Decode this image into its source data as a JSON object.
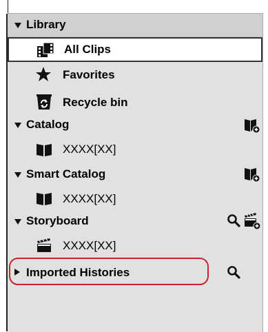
{
  "tree": {
    "library": {
      "label": "Library",
      "icon": "triangle-down-icon"
    },
    "all_clips": {
      "label": "All Clips",
      "icon": "film-clips-icon"
    },
    "favorites": {
      "label": "Favorites",
      "icon": "star-icon"
    },
    "recycle_bin": {
      "label": "Recycle bin",
      "icon": "recycle-bin-icon"
    },
    "catalog": {
      "label": "Catalog",
      "icon": "book-add-icon"
    },
    "catalog_item": {
      "label": "XXXX[XX]",
      "icon": "book-icon"
    },
    "smart_catalog": {
      "label": "Smart Catalog",
      "icon": "book-add-icon"
    },
    "smart_catalog_item": {
      "label": "XXXX[XX]",
      "icon": "book-icon"
    },
    "storyboard": {
      "label": "Storyboard",
      "icons": [
        "search-icon",
        "clapperboard-add-icon"
      ]
    },
    "storyboard_item": {
      "label": "XXXX[XX]",
      "icon": "clapperboard-icon"
    },
    "imported_histories": {
      "label": "Imported Histories",
      "icon": "search-icon"
    }
  },
  "colors": {
    "highlight": "#c4242b",
    "panel": "#e1e1e1",
    "selected": "#ffffff"
  }
}
